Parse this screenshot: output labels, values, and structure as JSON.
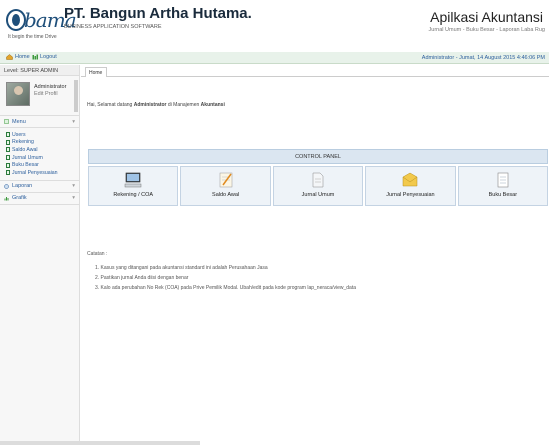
{
  "header": {
    "logo_word": "bama",
    "logo_tagline": "It begin the time  Drive",
    "company_name": "PT. Bangun Artha Hutama.",
    "company_subtitle": "BUSINESS APPLICATION SOFTWARE",
    "app_title": "Apilkasi Akuntansi",
    "app_subtitle": "Jurnal Umum - Buku Besar - Laporan Laba Rug"
  },
  "navbar": {
    "home_label": "Home",
    "logout_label": "Logout",
    "user_info": "Administrator  - Jumat, 14 August 2015 4:46:06 PM"
  },
  "sidebar": {
    "level": "Level: SUPER ADMIN",
    "profile_name": "Administrator",
    "profile_edit": "Edit Profil",
    "menu_label": "Menu",
    "menu_items": [
      {
        "label": "Users"
      },
      {
        "label": "Rekening"
      },
      {
        "label": "Saldo Awal"
      },
      {
        "label": "Jurnal Umum"
      },
      {
        "label": "Buku Besar"
      },
      {
        "label": "Jurnal Penyesuaian"
      }
    ],
    "laporan_label": "Laporan",
    "grafik_label": "Grafik"
  },
  "main": {
    "tab_label": "Home",
    "welcome_prefix": "Hai, Selamat datang ",
    "welcome_user": "Administrator",
    "welcome_middle": " di Manajemen ",
    "welcome_app": "Akuntansi",
    "panel_title": "CONTROL PANEL",
    "tiles": [
      {
        "label": "Rekening / COA",
        "icon": "computer-icon"
      },
      {
        "label": "Saldo Awal",
        "icon": "notepad-icon"
      },
      {
        "label": "Jurnal Umum",
        "icon": "document-icon"
      },
      {
        "label": "Jurnal Penyesuaian",
        "icon": "envelope-icon"
      },
      {
        "label": "Buku Besar",
        "icon": "notebook-icon"
      }
    ],
    "notes_title": "Catatan :",
    "notes": [
      "1. Kasus yang ditangani pada akuntansi standard ini adalah Perusahaan Jasa",
      "2. Pastikan jurnal Anda diisi dengan benar",
      "3. Kalo ada perubahan No Rek (COA) pada Prive Pemilik Modal. Ubah/edit pada kode program lap_neraca/view_data"
    ]
  },
  "colors": {
    "accent": "#2b5e9c",
    "navbar_bg": "#e8f2ea",
    "panel_head_bg": "#dbe6f1",
    "tile_bg": "#eef3f8"
  }
}
